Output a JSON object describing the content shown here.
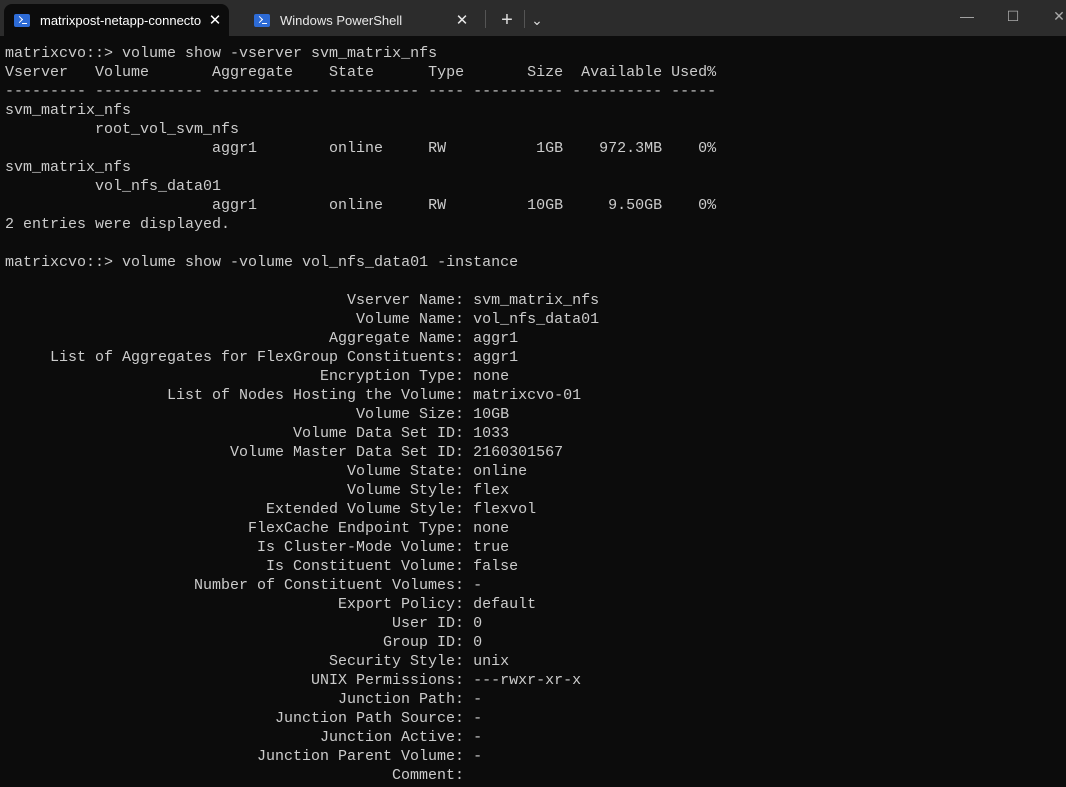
{
  "tabs": [
    {
      "label": "matrixpost-netapp-connector",
      "icon": "powershell-icon",
      "active": true
    },
    {
      "label": "Windows PowerShell",
      "icon": "powershell-icon",
      "active": false
    }
  ],
  "toolbar": {
    "new_tab": "+",
    "dropdown": "⌄"
  },
  "window": {
    "minimize": "—",
    "maximize": "☐",
    "close": "✕"
  },
  "terminal": {
    "lines": [
      "matrixcvo::> volume show -vserver svm_matrix_nfs",
      "Vserver   Volume       Aggregate    State      Type       Size  Available Used%",
      "--------- ------------ ------------ ---------- ---- ---------- ---------- -----",
      "svm_matrix_nfs",
      "          root_vol_svm_nfs",
      "                       aggr1        online     RW          1GB    972.3MB    0%",
      "svm_matrix_nfs",
      "          vol_nfs_data01",
      "                       aggr1        online     RW         10GB     9.50GB    0%",
      "2 entries were displayed.",
      "",
      "matrixcvo::> volume show -volume vol_nfs_data01 -instance",
      ""
    ],
    "instance": [
      {
        "k": "Vserver Name",
        "v": "svm_matrix_nfs"
      },
      {
        "k": "Volume Name",
        "v": "vol_nfs_data01"
      },
      {
        "k": "Aggregate Name",
        "v": "aggr1"
      },
      {
        "k": "List of Aggregates for FlexGroup Constituents",
        "v": "aggr1"
      },
      {
        "k": "Encryption Type",
        "v": "none"
      },
      {
        "k": "List of Nodes Hosting the Volume",
        "v": "matrixcvo-01"
      },
      {
        "k": "Volume Size",
        "v": "10GB"
      },
      {
        "k": "Volume Data Set ID",
        "v": "1033"
      },
      {
        "k": "Volume Master Data Set ID",
        "v": "2160301567"
      },
      {
        "k": "Volume State",
        "v": "online"
      },
      {
        "k": "Volume Style",
        "v": "flex"
      },
      {
        "k": "Extended Volume Style",
        "v": "flexvol"
      },
      {
        "k": "FlexCache Endpoint Type",
        "v": "none"
      },
      {
        "k": "Is Cluster-Mode Volume",
        "v": "true"
      },
      {
        "k": "Is Constituent Volume",
        "v": "false"
      },
      {
        "k": "Number of Constituent Volumes",
        "v": "-"
      },
      {
        "k": "Export Policy",
        "v": "default"
      },
      {
        "k": "User ID",
        "v": "0"
      },
      {
        "k": "Group ID",
        "v": "0"
      },
      {
        "k": "Security Style",
        "v": "unix"
      },
      {
        "k": "UNIX Permissions",
        "v": "---rwxr-xr-x"
      },
      {
        "k": "Junction Path",
        "v": "-"
      },
      {
        "k": "Junction Path Source",
        "v": "-"
      },
      {
        "k": "Junction Active",
        "v": "-"
      },
      {
        "k": "Junction Parent Volume",
        "v": "-"
      },
      {
        "k": "Comment",
        "v": ""
      }
    ]
  }
}
